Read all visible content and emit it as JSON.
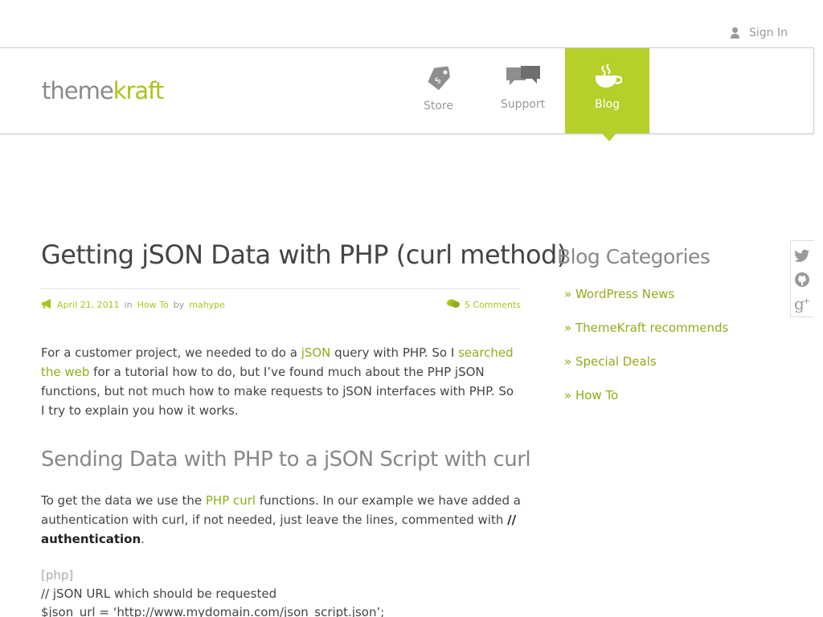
{
  "topbar": {
    "signin_label": "Sign In"
  },
  "header": {
    "logo_part1": "theme",
    "logo_part2": "kraft",
    "nav": [
      {
        "label": "Store",
        "icon": "price-tag-icon"
      },
      {
        "label": "Support",
        "icon": "speech-bubbles-icon"
      },
      {
        "label": "Blog",
        "icon": "coffee-cup-icon",
        "active": true
      }
    ]
  },
  "article": {
    "title": "Getting jSON Data with PHP (curl method)",
    "meta": {
      "date": "April 21, 2011",
      "in": "in",
      "category": "How To",
      "by": "by",
      "author": "mahype",
      "comments": "5 Comments"
    },
    "para1": {
      "t1": "For a customer project, we needed to do a ",
      "link1": "jSON",
      "t2": " query with PHP. So I ",
      "link2": "searched the web",
      "t3": " for a tutorial how to do, but I’ve found much about the PHP jSON functions, but not much how to make requests to jSON interfaces with PHP. So I try to explain you how it works."
    },
    "subheading": "Sending Data with PHP to a  jSON Script with curl",
    "para2": {
      "t1": "To get the data we use the ",
      "link1": "PHP curl",
      "t2": " functions. In our example we have added a authentication with curl, if not needed, just leave the lines, commented with ",
      "bold": "// authentication",
      "t3": "."
    },
    "code": {
      "tag": "[php]",
      "line1": "// jSON URL which should be requested",
      "line2": "$json_url = ‘http://www.mydomain.com/json_script.json’;"
    }
  },
  "sidebar": {
    "title": "Blog Categories",
    "items": [
      "» WordPress News",
      "» ThemeKraft recommends",
      "» Special Deals",
      "» How To"
    ]
  },
  "social": [
    "twitter-icon",
    "github-icon",
    "google-plus-icon"
  ],
  "colors": {
    "accent": "#b6cf2b",
    "link": "#8fae1b",
    "text": "#444444",
    "muted": "#999999"
  }
}
